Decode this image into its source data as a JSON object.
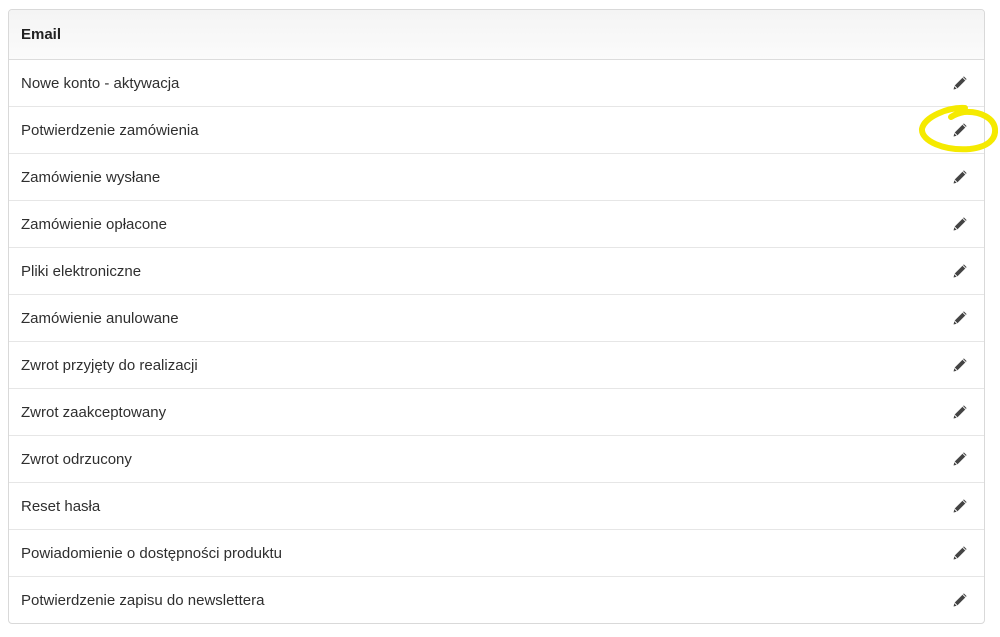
{
  "table": {
    "header": "Email",
    "rows": [
      {
        "label": "Nowe konto - aktywacja",
        "action_icon": "pencil-icon"
      },
      {
        "label": "Potwierdzenie zamówienia",
        "action_icon": "pencil-icon"
      },
      {
        "label": "Zamówienie wysłane",
        "action_icon": "pencil-icon"
      },
      {
        "label": "Zamówienie opłacone",
        "action_icon": "pencil-icon"
      },
      {
        "label": "Pliki elektroniczne",
        "action_icon": "pencil-icon"
      },
      {
        "label": "Zamówienie anulowane",
        "action_icon": "pencil-icon"
      },
      {
        "label": "Zwrot przyjęty do realizacji",
        "action_icon": "pencil-icon"
      },
      {
        "label": "Zwrot zaakceptowany",
        "action_icon": "pencil-icon"
      },
      {
        "label": "Zwrot odrzucony",
        "action_icon": "pencil-icon"
      },
      {
        "label": "Reset hasła",
        "action_icon": "pencil-icon"
      },
      {
        "label": "Powiadomienie o dostępności produktu",
        "action_icon": "pencil-icon"
      },
      {
        "label": "Potwierdzenie zapisu do newslettera",
        "action_icon": "pencil-icon"
      }
    ]
  },
  "annotation": {
    "type": "yellow-circle-highlight",
    "target_row": 1,
    "color": "#f5ea00"
  },
  "colors": {
    "text": "#2f2f2f",
    "border": "#d9d9d9",
    "icon": "#444444"
  }
}
